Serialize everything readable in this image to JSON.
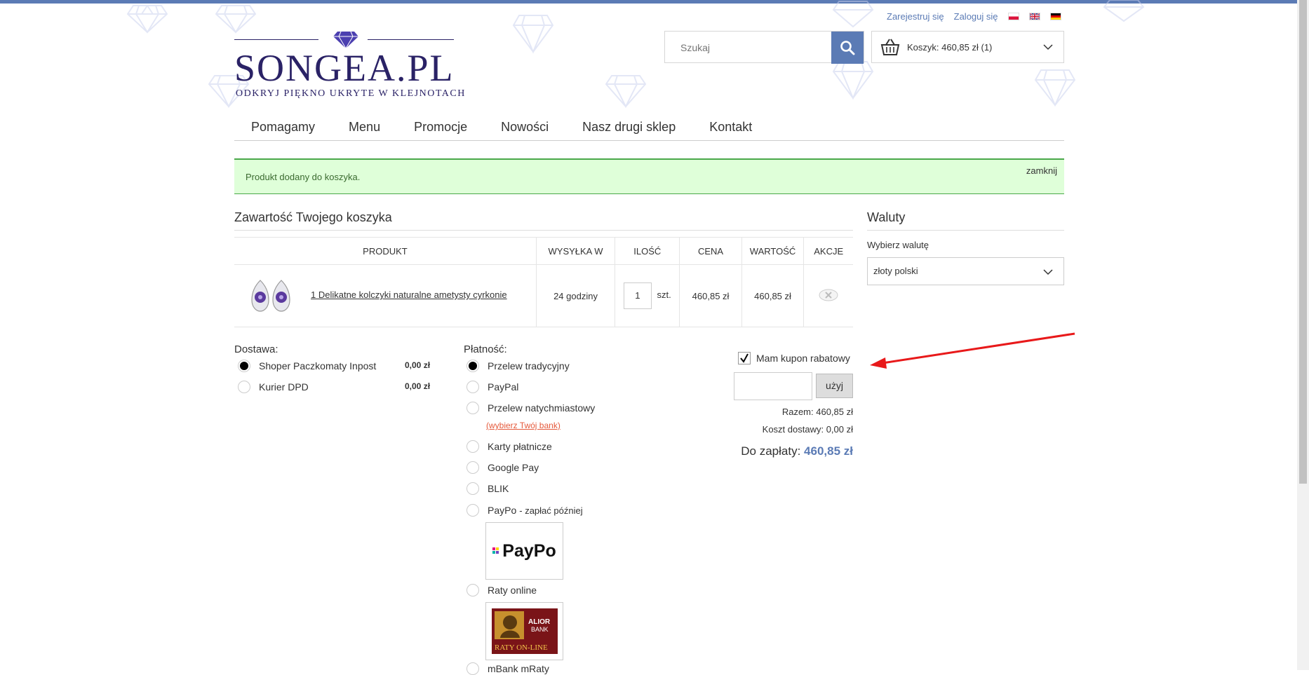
{
  "header": {
    "register_link": "Zarejestruj się",
    "login_link": "Zaloguj się",
    "logo_text": "SONGEA.PL",
    "logo_tagline": "ODKRYJ PIĘKNO UKRYTE W KLEJNOTACH",
    "search_placeholder": "Szukaj",
    "cart_label": "Koszyk: 460,85 zł (1)"
  },
  "nav": {
    "items": [
      "Pomagamy",
      "Menu",
      "Promocje",
      "Nowości",
      "Nasz drugi sklep",
      "Kontakt"
    ]
  },
  "alert": {
    "message": "Produkt dodany do koszyka.",
    "close_label": "zamknij"
  },
  "cart": {
    "heading": "Zawartość Twojego koszyka",
    "columns": [
      "PRODUKT",
      "WYSYŁKA W",
      "ILOŚĆ",
      "CENA",
      "WARTOŚĆ",
      "AKCJE"
    ],
    "rows": [
      {
        "product_name": "1 Delikatne kolczyki naturalne ametysty cyrkonie",
        "shipping": "24 godziny",
        "quantity": "1",
        "unit": "szt.",
        "price": "460,85 zł",
        "value": "460,85 zł"
      }
    ]
  },
  "currency": {
    "heading": "Waluty",
    "label": "Wybierz walutę",
    "selected": "złoty polski"
  },
  "delivery": {
    "heading": "Dostawa:",
    "options": [
      {
        "label": "Shoper Paczkomaty Inpost",
        "price": "0,00 zł",
        "selected": true
      },
      {
        "label": "Kurier DPD",
        "price": "0,00 zł",
        "selected": false
      }
    ]
  },
  "payment": {
    "heading": "Płatność:",
    "options": [
      {
        "label": "Przelew tradycyjny",
        "selected": true
      },
      {
        "label": "PayPal",
        "selected": false
      },
      {
        "label": "Przelew natychmiastowy",
        "selected": false
      },
      {
        "label": "Karty płatnicze",
        "selected": false
      },
      {
        "label": "Google Pay",
        "selected": false
      },
      {
        "label": "BLIK",
        "selected": false
      },
      {
        "label": "PayPo",
        "selected": false
      },
      {
        "label": "Raty online",
        "selected": false
      },
      {
        "label": "mBank mRaty",
        "selected": false
      }
    ],
    "bank_link": "(wybierz Twój bank)",
    "paypo_suffix": "- zapłać później",
    "paypo_logo_text": "PayPo",
    "alior_logo_line1": "ALIOR",
    "alior_logo_line2": "BANK",
    "alior_logo_line3": "RATY ON-LINE"
  },
  "coupon": {
    "checkbox_label": "Mam kupon rabatowy",
    "checked": true,
    "button_label": "użyj"
  },
  "summary": {
    "subtotal": "Razem: 460,85 zł",
    "shipping": "Koszt dostawy: 0,00 zł",
    "total_label": "Do zapłaty:",
    "total_value": "460,85 zł"
  },
  "colors": {
    "accent": "#5b7bb5",
    "logo": "#2a2266",
    "alert_bg": "#dfffd9",
    "arrow": "#e8191a"
  }
}
